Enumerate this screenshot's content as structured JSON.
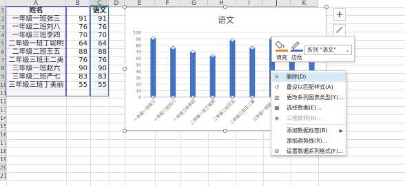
{
  "columns": [
    "A",
    "B",
    "C",
    "D",
    "E",
    "F",
    "G",
    "H",
    "I",
    "J",
    "K"
  ],
  "rows": [
    "1",
    "2",
    "3",
    "4",
    "5",
    "6",
    "7",
    "8",
    "9",
    "10",
    "11",
    "12",
    "13",
    "14",
    "15",
    "16",
    "17",
    "18",
    "19",
    "20",
    "21"
  ],
  "sheet": {
    "header": {
      "name": "姓名",
      "b": "",
      "c": "语文"
    },
    "records": [
      {
        "name": "一年级一班张三",
        "b": "91",
        "c": "91"
      },
      {
        "name": "一年级二班刘八",
        "b": "76",
        "c": "76"
      },
      {
        "name": "一年级三班李四",
        "b": "70",
        "c": "70"
      },
      {
        "name": "二年级一班丁聪明",
        "b": "64",
        "c": "64"
      },
      {
        "name": "二年级二班王五",
        "b": "88",
        "c": "88"
      },
      {
        "name": "二年级三班王二美",
        "b": "76",
        "c": "76"
      },
      {
        "name": "三年级一班赵六",
        "b": "90",
        "c": "90"
      },
      {
        "name": "三年级二班严七",
        "b": "83",
        "c": "83"
      },
      {
        "name": "三年级三班丁美丽",
        "b": "55",
        "c": "55"
      }
    ]
  },
  "chart_data": {
    "type": "bar",
    "title": "语文",
    "categories": [
      "一年级一班张三",
      "一年级二班刘八",
      "一年级三班李四",
      "二年级一班丁聪明",
      "二年级二班王五",
      "二年级三班王二美",
      "三年级一班赵六",
      "三年级二班严七",
      "三年级三班丁美丽"
    ],
    "series": [
      {
        "name": "语文",
        "values": [
          91,
          76,
          70,
          64,
          88,
          76,
          90,
          83,
          55
        ],
        "color": "#4472c4"
      }
    ],
    "ylim": [
      0,
      100
    ],
    "yticks": [
      0,
      10,
      20,
      30,
      40,
      50,
      60,
      70,
      80,
      90,
      100
    ],
    "xlabel": "",
    "ylabel": "",
    "grid": true,
    "selected_series": "语文"
  },
  "side_buttons": {
    "add_element": "+",
    "style_brush": "🖌"
  },
  "minibar": {
    "fill_label": "填充",
    "border_label": "边框",
    "series_value": "系列 \"语文\"",
    "fill_color": "#ed7d31",
    "border_color": "#4472c4"
  },
  "context_menu": {
    "items": [
      {
        "label": "删除(D)",
        "icon": "delete-icon",
        "glyph": "✕",
        "highlighted": true,
        "disabled": false,
        "submenu": false
      },
      {
        "label": "重设以匹配样式(A)",
        "icon": "reset-style-icon",
        "glyph": "↺",
        "highlighted": false,
        "disabled": false,
        "submenu": false
      },
      {
        "label": "更改系列图表类型(Y)...",
        "icon": "chart-type-icon",
        "glyph": "▥",
        "highlighted": false,
        "disabled": false,
        "submenu": false
      },
      {
        "label": "选择数据(E)...",
        "icon": "select-data-icon",
        "glyph": "▦",
        "highlighted": false,
        "disabled": false,
        "submenu": false
      },
      {
        "label": "三维旋转(R)...",
        "icon": "rotate-3d-icon",
        "glyph": "◈",
        "highlighted": false,
        "disabled": true,
        "submenu": false
      },
      {
        "label": "添加数据标签(B)",
        "icon": "",
        "glyph": "",
        "highlighted": false,
        "disabled": false,
        "submenu": true
      },
      {
        "label": "添加趋势线(R)...",
        "icon": "",
        "glyph": "",
        "highlighted": false,
        "disabled": false,
        "submenu": false
      },
      {
        "label": "设置数据系列格式(F)...",
        "icon": "format-series-icon",
        "glyph": "⚙",
        "highlighted": false,
        "disabled": false,
        "submenu": false
      }
    ]
  },
  "colors": {
    "accent_green": "#217346",
    "selection_border": "#3b6fc0",
    "menu_highlight": "#d7e8f7"
  }
}
